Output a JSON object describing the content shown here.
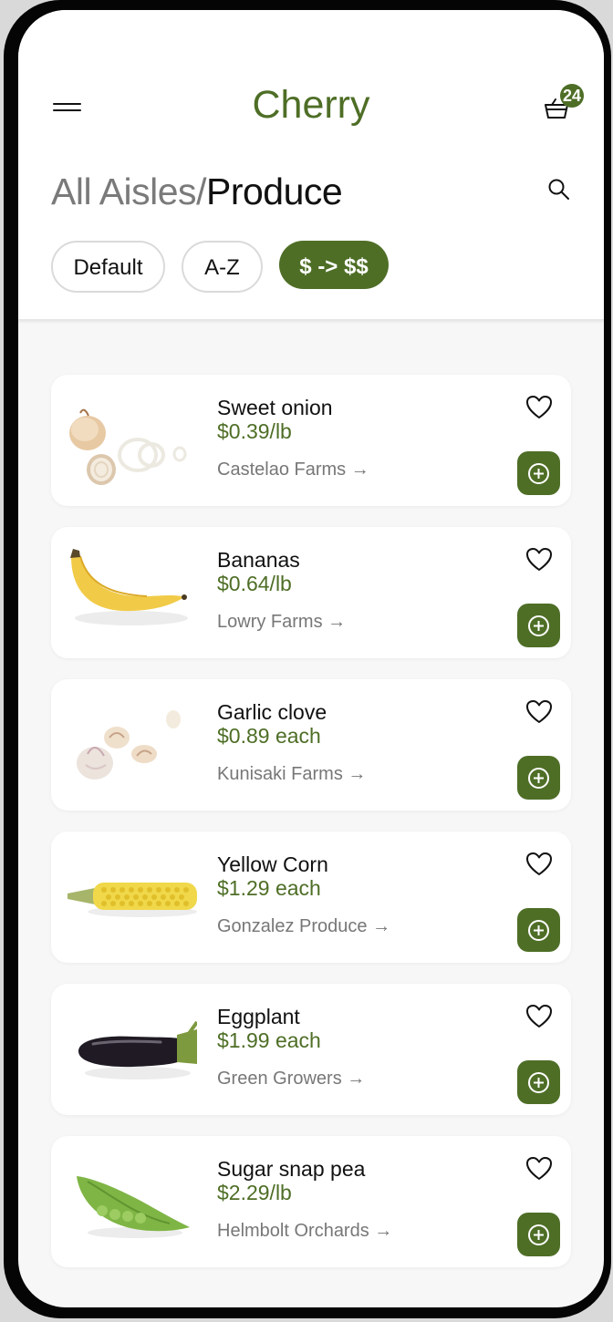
{
  "app": {
    "brand": "Cherry",
    "cart_count": "24"
  },
  "breadcrumb": {
    "parent": "All Aisles",
    "separator": "/",
    "current": "Produce"
  },
  "sort": {
    "options": [
      "Default",
      "A-Z",
      "$ -> $$"
    ],
    "active": "$ -> $$"
  },
  "colors": {
    "accent": "#4e6e26",
    "muted_text": "#777777",
    "background": "#f7f7f7"
  },
  "products": [
    {
      "name": "Sweet onion",
      "price": "$0.39/lb",
      "farm": "Castelao Farms →",
      "image": "onion"
    },
    {
      "name": "Bananas",
      "price": "$0.64/lb",
      "farm": "Lowry Farms →",
      "image": "banana"
    },
    {
      "name": "Garlic clove",
      "price": "$0.89 each",
      "farm": "Kunisaki Farms →",
      "image": "garlic"
    },
    {
      "name": "Yellow Corn",
      "price": "$1.29 each",
      "farm": "Gonzalez Produce →",
      "image": "corn"
    },
    {
      "name": "Eggplant",
      "price": "$1.99 each",
      "farm": "Green Growers →",
      "image": "eggplant"
    },
    {
      "name": "Sugar snap pea",
      "price": "$2.29/lb",
      "farm": "Helmbolt Orchards →",
      "image": "peapod"
    }
  ]
}
